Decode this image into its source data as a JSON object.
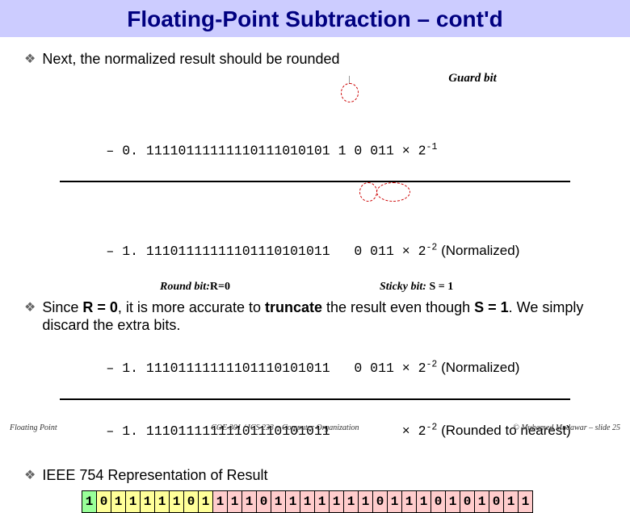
{
  "title": "Floating-Point Subtraction – cont'd",
  "bullets": {
    "b1": "Next, the normalized result should be rounded",
    "b2_a": "Since ",
    "b2_b": "R = 0",
    "b2_c": ", it is more accurate to ",
    "b2_d": "truncate",
    "b2_e": " the result even though ",
    "b2_f": "S = 1",
    "b2_g": ". We simply discard the extra bits.",
    "b3": "IEEE 754 Representation of Result"
  },
  "labels": {
    "guard": "Guard bit",
    "round": "Round bit:",
    "round_val": " R=0",
    "sticky": "Sticky bit:",
    "sticky_val": " S = 1",
    "normalized": " (Normalized)",
    "rounded": " (Rounded to nearest)"
  },
  "calc": {
    "line1_pre": "– 0. 11110111111110111010101 ",
    "line1_g": "1",
    "line1_post": " 0 011 × 2",
    "line1_exp": "-1",
    "line2_pre": "– 1. 11101111111101110101011   ",
    "line2_bits": "0 011",
    "line2_mid": " × 2",
    "line2_exp": "-2",
    "line3_pre": "– 1. 11101111111101110101011   0 011 × 2",
    "line3_exp": "-2",
    "line4_pre": "– 1. 11101111111101110101011         × 2",
    "line4_exp": "-2"
  },
  "ieee_bits": [
    "1",
    "0",
    "1",
    "1",
    "1",
    "1",
    "1",
    "0",
    "1",
    "1",
    "1",
    "1",
    "0",
    "1",
    "1",
    "1",
    "1",
    "1",
    "1",
    "1",
    "0",
    "1",
    "1",
    "1",
    "0",
    "1",
    "0",
    "1",
    "0",
    "1",
    "1"
  ],
  "footer": {
    "left": "Floating Point",
    "center": "COE 301 / ICS 233 – Computer Organization",
    "right": "© Muhamed Mudawar – slide 25"
  }
}
